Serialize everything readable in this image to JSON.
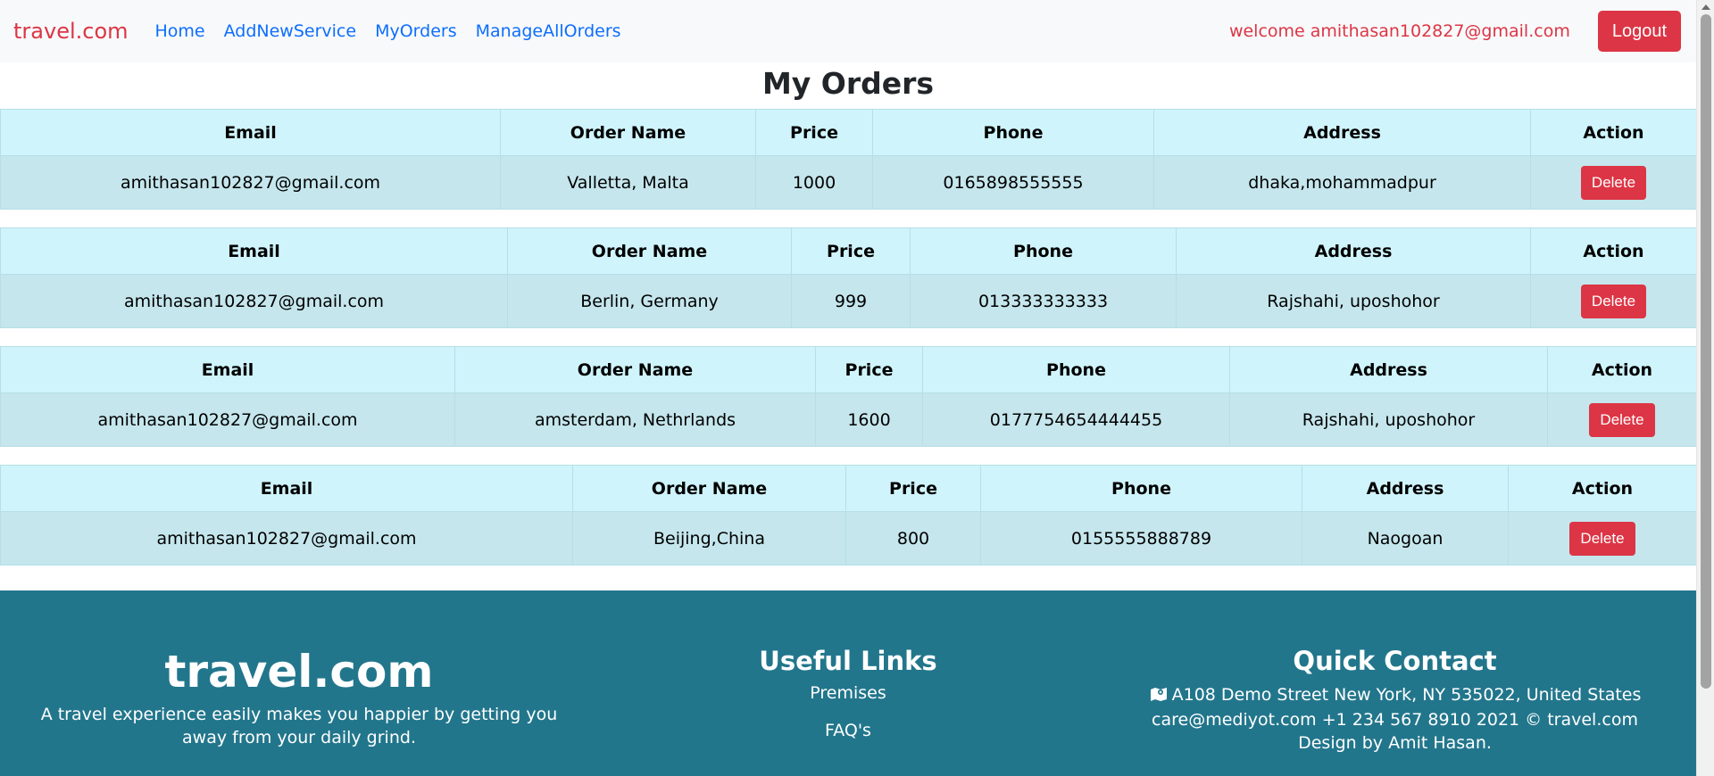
{
  "navbar": {
    "brand": "travel.com",
    "links": [
      "Home",
      "AddNewService",
      "MyOrders",
      "ManageAllOrders"
    ],
    "welcome": "welcome amithasan102827@gmail.com",
    "logout": "Logout"
  },
  "page": {
    "title": "My Orders"
  },
  "table_headers": [
    "Email",
    "Order Name",
    "Price",
    "Phone",
    "Address",
    "Action"
  ],
  "orders": [
    {
      "email": "amithasan102827@gmail.com",
      "order_name": "Valletta, Malta",
      "price": "1000",
      "phone": "0165898555555",
      "address": "dhaka,mohammadpur",
      "action": "Delete"
    },
    {
      "email": "amithasan102827@gmail.com",
      "order_name": "Berlin, Germany",
      "price": "999",
      "phone": "013333333333",
      "address": "Rajshahi, uposhohor",
      "action": "Delete"
    },
    {
      "email": "amithasan102827@gmail.com",
      "order_name": "amsterdam, Nethrlands",
      "price": "1600",
      "phone": "0177754654444455",
      "address": "Rajshahi, uposhohor",
      "action": "Delete"
    },
    {
      "email": "amithasan102827@gmail.com",
      "order_name": "Beijing,China",
      "price": "800",
      "phone": "0155555888789",
      "address": "Naogoan",
      "action": "Delete"
    }
  ],
  "footer": {
    "brand": "travel.com",
    "description": "A travel experience easily makes you happier by getting you away from your daily grind.",
    "useful_links_title": "Useful Links",
    "useful_links": [
      "Premises",
      "FAQ's"
    ],
    "quick_contact_title": "Quick Contact",
    "contact_text": "A108 Demo Street New York, NY 535022, United States care@mediyot.com +1 234 567 8910 2021 © travel.com Design by Amit Hasan."
  },
  "colors": {
    "brand_red": "#dc3545",
    "link_blue": "#0d6efd",
    "table_header_bg": "#cff4fc",
    "table_row_bg": "#c5e6ed",
    "footer_bg": "#22768c"
  }
}
